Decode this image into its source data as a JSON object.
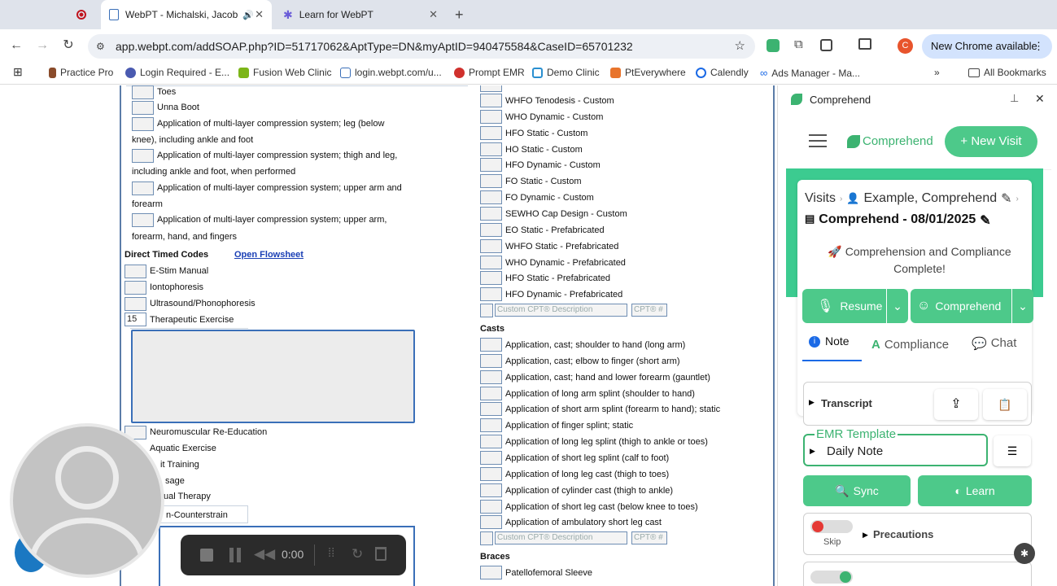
{
  "tabs": [
    {
      "label": "WebPT - Michalski, Jacob"
    },
    {
      "label": "Learn for WebPT"
    }
  ],
  "url": "app.webpt.com/addSOAP.php?ID=51717062&AptType=DN&myAptID=940475584&CaseID=65701232",
  "new_chrome": "New Chrome available",
  "profile_letter": "C",
  "bookmarks": [
    "Practice Pro",
    "Login Required - E...",
    "Fusion Web Clinic",
    "login.webpt.com/u...",
    "Prompt EMR",
    "Demo Clinic",
    "PtEverywhere",
    "Calendly",
    "Ads Manager - Ma..."
  ],
  "all_bookmarks": "All Bookmarks",
  "left_items": [
    "Toes",
    "Unna Boot",
    "Application of multi-layer compression system; leg (below",
    "knee), including ankle and foot",
    "Application of multi-layer compression system; thigh and leg,",
    "including ankle and foot, when performed",
    "Application of multi-layer compression system; upper arm and",
    "forearm",
    "Application of multi-layer compression system; upper arm,",
    "forearm, hand, and fingers"
  ],
  "direct_timed": {
    "title": "Direct Timed Codes",
    "flowsheet": "Open Flowsheet",
    "items": [
      "E-Stim Manual",
      "Iontophoresis",
      "Ultrasound/Phonophoresis",
      "Therapeutic Exercise",
      "Neuromuscular Re-Education",
      "Aquatic Exercise",
      "it Training",
      "sage",
      "ual Therapy",
      "n-Counterstrain"
    ],
    "exercise_minutes": "15"
  },
  "right_items": [
    "WHFO Tenodesis - Custom",
    "WHO Dynamic - Custom",
    "HFO Static - Custom",
    "HO Static - Custom",
    "HFO Dynamic - Custom",
    "FO Static - Custom",
    "FO Dynamic - Custom",
    "SEWHO Cap Design - Custom",
    "EO Static - Prefabricated",
    "WHFO Static - Prefabricated",
    "WHO Dynamic - Prefabricated",
    "HFO Static - Prefabricated",
    "HFO Dynamic - Prefabricated"
  ],
  "custom_desc": "Custom CPT® Description",
  "custom_cpt": "CPT® #",
  "casts": {
    "title": "Casts",
    "items": [
      "Application, cast; shoulder to hand (long arm)",
      "Application, cast; elbow to finger (short arm)",
      "Application, cast; hand and lower forearm (gauntlet)",
      "Application of long arm splint (shoulder to hand)",
      "Application of short arm splint (forearm to hand); static",
      "Application of finger splint; static",
      "Application of long leg splint (thigh to ankle or toes)",
      "Application of short leg splint (calf to foot)",
      "Application of long leg cast (thigh to toes)",
      "Application of cylinder cast (thigh to ankle)",
      "Application of short leg cast (below knee to toes)",
      "Application of ambulatory short leg cast"
    ]
  },
  "braces": {
    "title": "Braces",
    "items": [
      "Patellofemoral Sleeve"
    ]
  },
  "panel": {
    "title": "Comprehend",
    "logo": "Comprehend",
    "new_visit": "+ New Visit",
    "visits": "Visits",
    "patient": "Example, Comprehend",
    "note_title": "Comprehend - 08/01/2025",
    "complete_msg": "🚀 Comprehension and Compliance Complete!",
    "resume": "Resume",
    "comprehend_btn": "Comprehend",
    "tabs": [
      "Note",
      "Compliance",
      "Chat"
    ],
    "transcript": "Transcript",
    "emr_template_label": "EMR Template",
    "emr_template_value": "Daily Note",
    "sync": "Sync",
    "learn": "Learn",
    "skip": "Skip",
    "precautions": "Precautions"
  },
  "recorder": {
    "time": "0:00"
  },
  "colors": {
    "accent_green": "#4dc98a",
    "brand_green": "#3cb371",
    "link_blue": "#1a3fb5"
  }
}
